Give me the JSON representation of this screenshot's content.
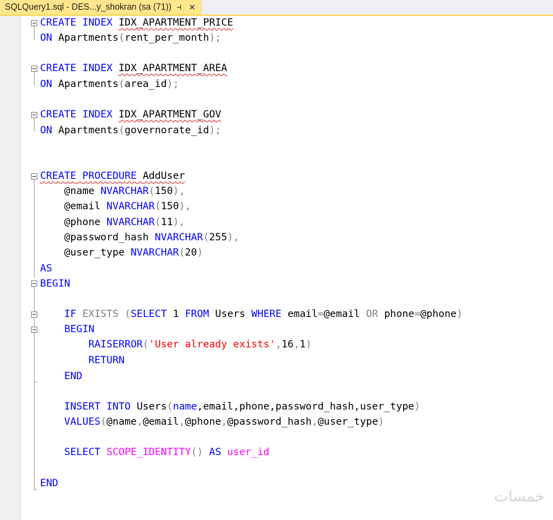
{
  "tab": {
    "title": "SQLQuery1.sql - DES...y_shokran (sa (71))",
    "pin_icon": "pin-icon",
    "close_icon": "close-icon",
    "accent_color": "#ffe58c"
  },
  "editor": {
    "l01": {
      "a": "CREATE",
      "b": " ",
      "c": "INDEX",
      "d": " ",
      "e": "IDX_APARTMENT_PRICE"
    },
    "l02": {
      "a": "ON",
      "b": " Apartments",
      "c": "(",
      "d": "rent_per_month",
      "e": ");"
    },
    "l03": {
      "a": "CREATE",
      "b": " ",
      "c": "INDEX",
      "d": " ",
      "e": "IDX_APARTMENT_AREA"
    },
    "l04": {
      "a": "ON",
      "b": " Apartments",
      "c": "(",
      "d": "area_id",
      "e": ");"
    },
    "l05": {
      "a": "CREATE",
      "b": " ",
      "c": "INDEX",
      "d": " ",
      "e": "IDX_APARTMENT_GOV"
    },
    "l06": {
      "a": "ON",
      "b": " Apartments",
      "c": "(",
      "d": "governorate_id",
      "e": ");"
    },
    "l07": {
      "a": "CREATE",
      "b": " ",
      "c": "PROCEDURE",
      "d": " ",
      "e": "AddUser"
    },
    "l08": {
      "a": "    @name ",
      "b": "NVARCHAR",
      "c": "(",
      "d": "150",
      "e": "),"
    },
    "l09": {
      "a": "    @email ",
      "b": "NVARCHAR",
      "c": "(",
      "d": "150",
      "e": "),"
    },
    "l10": {
      "a": "    @phone ",
      "b": "NVARCHAR",
      "c": "(",
      "d": "11",
      "e": "),"
    },
    "l11": {
      "a": "    @password_hash ",
      "b": "NVARCHAR",
      "c": "(",
      "d": "255",
      "e": "),"
    },
    "l12": {
      "a": "    @user_type ",
      "b": "NVARCHAR",
      "c": "(",
      "d": "20",
      "e": ")"
    },
    "l13": {
      "a": "AS"
    },
    "l14": {
      "a": "BEGIN"
    },
    "l15": {
      "a": "    ",
      "b": "IF",
      "c": " ",
      "d": "EXISTS",
      "e": " (",
      "f": "SELECT",
      "g": " 1 ",
      "h": "FROM",
      "i": " Users ",
      "j": "WHERE",
      "k": " email",
      "l": "=",
      "m": "@email ",
      "n": "OR",
      "o": " phone",
      "p": "=",
      "q": "@phone",
      "r": ")"
    },
    "l16": {
      "a": "    ",
      "b": "BEGIN"
    },
    "l17": {
      "a": "        ",
      "b": "RAISERROR",
      "c": "(",
      "d": "'User already exists'",
      "e": ",",
      "f": "16",
      "g": ",",
      "h": "1",
      "i": ")"
    },
    "l18": {
      "a": "        ",
      "b": "RETURN"
    },
    "l19": {
      "a": "    ",
      "b": "END"
    },
    "l20": {
      "a": "    ",
      "b": "INSERT",
      "c": " ",
      "d": "INTO",
      "e": " Users",
      "f": "(",
      "g": "name",
      "h": ",email,phone,password_hash,user_type",
      "i": ")"
    },
    "l21": {
      "a": "    ",
      "b": "VALUES",
      "c": "(",
      "d": "@name",
      "e": ",",
      "f": "@email",
      "g": ",",
      "h": "@phone",
      "i": ",",
      "j": "@password_hash",
      "k": ",",
      "l": "@user_type",
      "m": ")"
    },
    "l22": {
      "a": "    ",
      "b": "SELECT",
      "c": " ",
      "d": "SCOPE_IDENTITY",
      "e": "()",
      "f": " ",
      "g": "AS",
      "h": " ",
      "i": "user_id"
    },
    "l23": {
      "a": "END"
    }
  },
  "colors": {
    "keyword": "#0000ff",
    "operator": "#808080",
    "string": "#ff0000",
    "function": "#ff00ff",
    "error_squiggle": "#e53030"
  },
  "watermark": {
    "text": "خمسات"
  }
}
